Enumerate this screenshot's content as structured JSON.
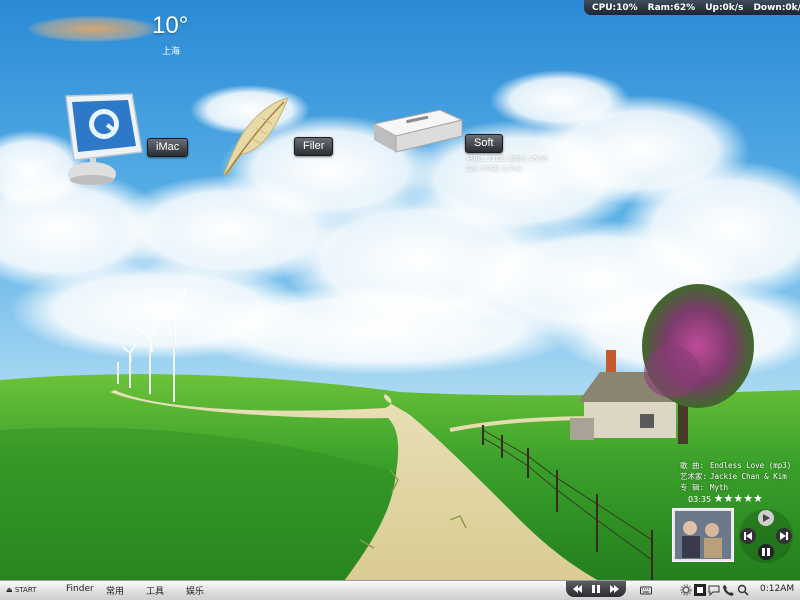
{
  "status_bar": {
    "cpu": "CPU:10%",
    "ram": "Ram:62%",
    "up": "Up:0k/s",
    "down": "Down:0k/s"
  },
  "weather": {
    "temperature": "10°",
    "city": "上海"
  },
  "shortcuts": [
    {
      "label": "iMac",
      "icon": "imac-icon"
    },
    {
      "label": "Filer",
      "icon": "feather-icon"
    },
    {
      "label": "Soft",
      "icon": "hard-drive-icon"
    }
  ],
  "disk": {
    "line1": "已用1.31GB 剩余8.45GB",
    "line2": "共9.76GB (13%)"
  },
  "music": {
    "title_label": "歌  曲:",
    "title": "Endless Love (mp3)",
    "artist_label": "艺术家:",
    "artist": "Jackie Chan & Kim",
    "album_label": "专  辑:",
    "album": "Myth",
    "time": "03:35",
    "rating": 5,
    "stars": "★★★★★"
  },
  "taskbar": {
    "start": "START",
    "items": [
      "Finder",
      "常用",
      "工具",
      "娱乐"
    ],
    "clock": "0:12AM"
  },
  "colors": {
    "sky_top": "#2f8fd8",
    "sky_bottom": "#bfe2f7",
    "grass": "#3fa82a",
    "path": "#e7dcae"
  }
}
